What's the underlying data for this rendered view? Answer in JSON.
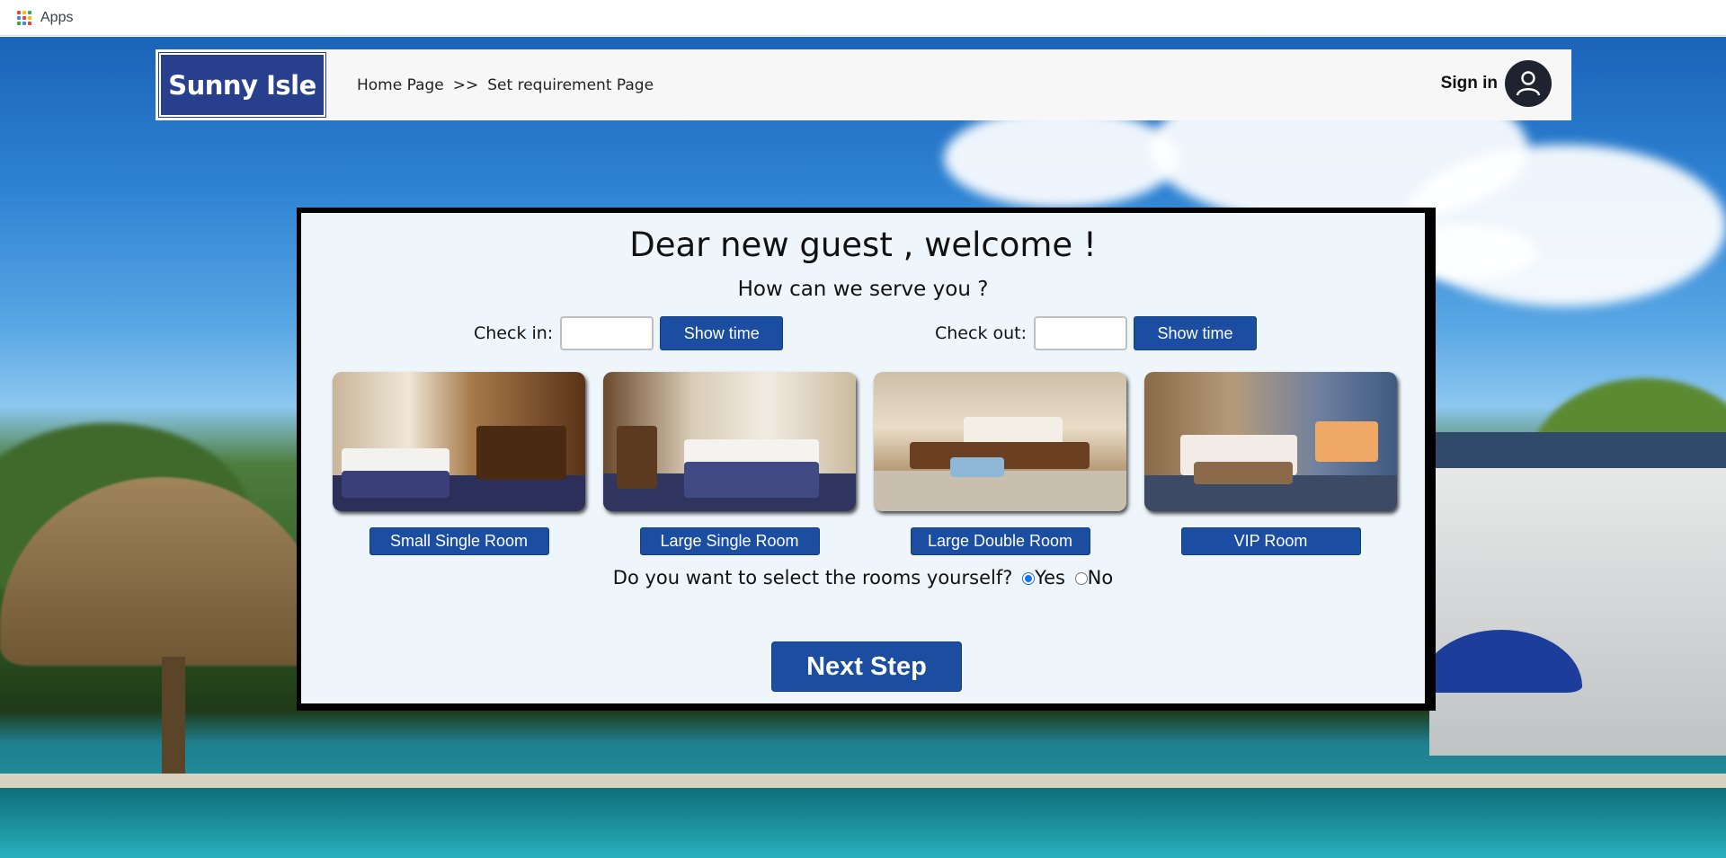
{
  "browser": {
    "apps_label": "Apps",
    "apps_icon_colors": [
      "#ea4335",
      "#fbbc04",
      "#34a853",
      "#4285f4",
      "#ea4335",
      "#fbbc04",
      "#34a853",
      "#4285f4",
      "#ea4335"
    ]
  },
  "header": {
    "logo_text": "Sunny Isle",
    "breadcrumb": {
      "home": "Home Page",
      "separator": ">>",
      "current": "Set requirement Page"
    },
    "sign_in_label": "Sign in",
    "avatar_icon": "user-icon"
  },
  "card": {
    "welcome": "Dear new guest , welcome !",
    "subtitle": "How can we serve you ?",
    "check_in": {
      "label": "Check in:",
      "value": "",
      "button": "Show time"
    },
    "check_out": {
      "label": "Check out:",
      "value": "",
      "button": "Show time"
    },
    "rooms": [
      {
        "name": "Small Single Room"
      },
      {
        "name": "Large Single Room"
      },
      {
        "name": "Large Double Room"
      },
      {
        "name": "VIP Room"
      }
    ],
    "select_question": "Do you want to select the rooms yourself?",
    "select_options": [
      {
        "label": "Yes",
        "checked": true
      },
      {
        "label": "No",
        "checked": false
      }
    ],
    "next_button": "Next Step"
  },
  "colors": {
    "brand_blue": "#1b4ea0",
    "logo_blue": "#283f8e",
    "card_bg": "#eef6fc"
  }
}
